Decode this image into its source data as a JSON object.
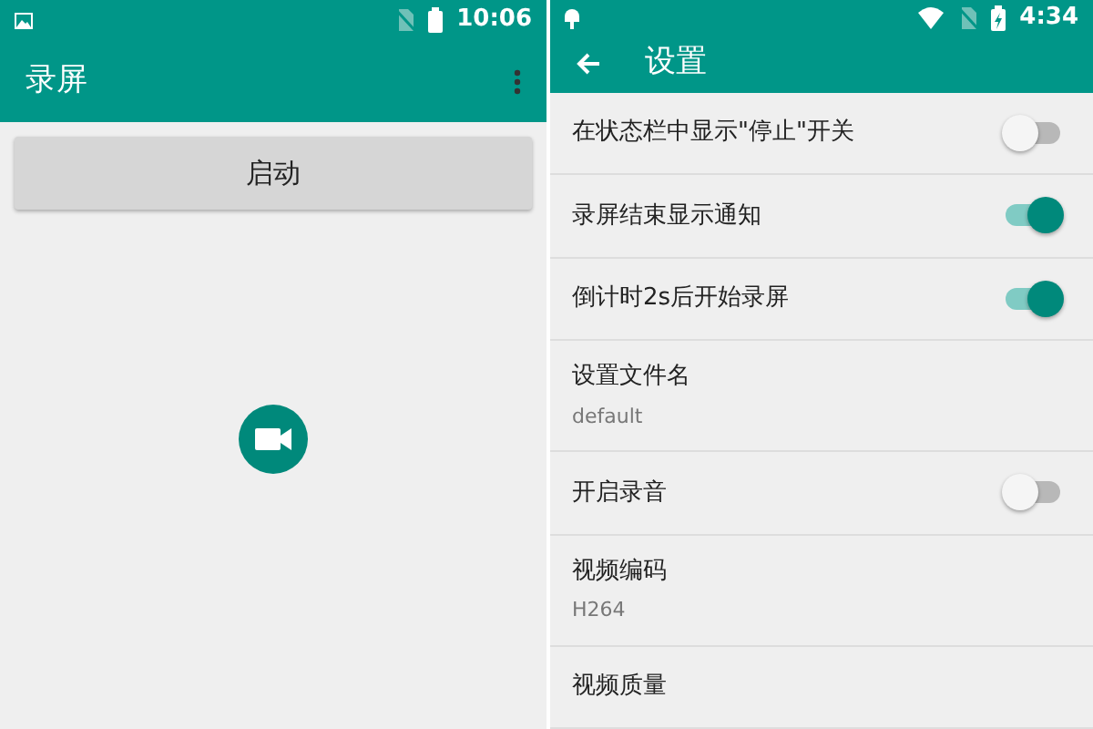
{
  "main_screen": {
    "status_bar": {
      "time": "10:06"
    },
    "toolbar": {
      "title": "录屏"
    },
    "start_button": {
      "label": "启动"
    }
  },
  "settings_screen": {
    "status_bar": {
      "time": "4:34"
    },
    "toolbar": {
      "title": "设置"
    },
    "items": [
      {
        "kind": "switch",
        "title": "在状态栏中显示\"停止\"开关",
        "on": false
      },
      {
        "kind": "switch",
        "title": "录屏结束显示通知",
        "on": true
      },
      {
        "kind": "switch",
        "title": "倒计时2s后开始录屏",
        "on": true
      },
      {
        "kind": "text",
        "title": "设置文件名",
        "summary": "default"
      },
      {
        "kind": "switch",
        "title": "开启录音",
        "on": false
      },
      {
        "kind": "text",
        "title": "视频编码",
        "summary": "H264"
      },
      {
        "kind": "text",
        "title": "视频质量"
      }
    ]
  }
}
